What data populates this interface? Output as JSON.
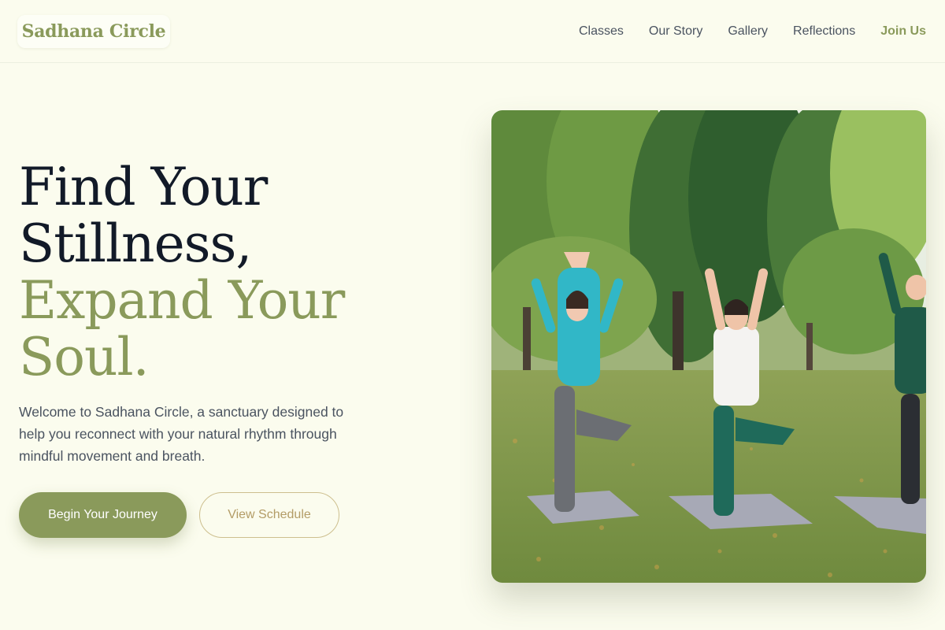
{
  "header": {
    "logo": "Sadhana Circle",
    "nav": [
      {
        "label": "Classes"
      },
      {
        "label": "Our Story"
      },
      {
        "label": "Gallery"
      },
      {
        "label": "Reflections"
      },
      {
        "label": "Join Us"
      }
    ]
  },
  "hero": {
    "title_line1": "Find Your",
    "title_line2": "Stillness,",
    "title_line3": "Expand Your",
    "title_line4": "Soul.",
    "description": "Welcome to Sadhana Circle, a sanctuary designed to help you reconnect with your natural rhythm through mindful movement and breath.",
    "primary_button": "Begin Your Journey",
    "secondary_button": "View Schedule",
    "image_subject": "three women in tree pose on yoga mats in a park"
  },
  "colors": {
    "background": "#fbfcee",
    "accent": "#8a9a5b",
    "heading": "#121a28",
    "body_text": "#4a5360",
    "secondary_button": "#b39c66"
  }
}
